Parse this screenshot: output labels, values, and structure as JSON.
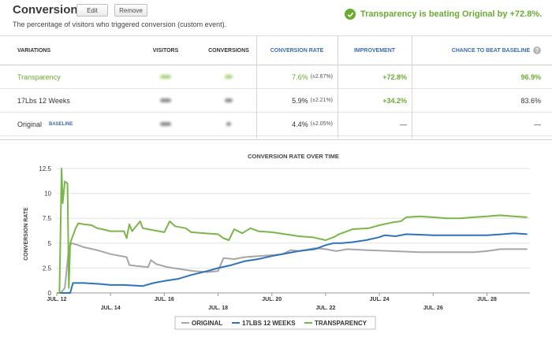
{
  "header": {
    "title": "Conversion",
    "edit_label": "Edit",
    "remove_label": "Remove",
    "subtitle": "The percentage of visitors who triggered conversion (custom event).",
    "banner": "Transparency is beating Original by +72.8%."
  },
  "table": {
    "headers": {
      "variations": "VARIATIONS",
      "visitors": "VISITORS",
      "conversions": "CONVERSIONS",
      "conversion_rate": "CONVERSION RATE",
      "improvement": "IMPROVEMENT",
      "chance": "CHANCE TO BEAT BASELINE"
    },
    "rows": [
      {
        "name": "Transparency",
        "rate": "7.6%",
        "rate_err": "(±2.67%)",
        "improvement": "+72.8%",
        "chance": "96.9%"
      },
      {
        "name": "17Lbs 12 Weeks",
        "rate": "5.9%",
        "rate_err": "(±2.21%)",
        "improvement": "+34.2%",
        "chance": "83.6%"
      },
      {
        "name": "Original",
        "baseline_tag": "BASELINE",
        "rate": "4.4%",
        "rate_err": "(±2.05%)",
        "improvement": "—",
        "chance": "—"
      }
    ]
  },
  "colors": {
    "original": "#a6a6a6",
    "weeks": "#2f72b8",
    "transparency": "#7ab648"
  },
  "chart_data": {
    "type": "line",
    "title": "CONVERSION RATE OVER TIME",
    "ylabel": "CONVERSION RATE",
    "xlabel": "",
    "ylim": [
      0,
      12.5
    ],
    "yticks": [
      0,
      2.5,
      5,
      7.5,
      10,
      12.5
    ],
    "ytick_labels": [
      "0",
      "2.5",
      "5",
      "7.5",
      "10",
      "12.5"
    ],
    "xlim": [
      12,
      29.6
    ],
    "xticks": [
      12,
      14,
      16,
      18,
      20,
      22,
      24,
      26,
      28
    ],
    "xtick_labels": [
      "JUL. 12",
      "JUL. 14",
      "JUL. 16",
      "JUL. 18",
      "JUL. 20",
      "JUL. 22",
      "JUL. 24",
      "JUL. 26",
      "JUL. 28"
    ],
    "grid": true,
    "legend": "bottom",
    "series": [
      {
        "name": "ORIGINAL",
        "points": [
          [
            12,
            0
          ],
          [
            12.15,
            0
          ],
          [
            12.3,
            0.5
          ],
          [
            12.45,
            4.5
          ],
          [
            12.55,
            5
          ],
          [
            12.8,
            4.8
          ],
          [
            13,
            4.6
          ],
          [
            13.5,
            4.3
          ],
          [
            14,
            3.9
          ],
          [
            14.6,
            3.6
          ],
          [
            14.7,
            2.8
          ],
          [
            15,
            2.7
          ],
          [
            15.4,
            2.6
          ],
          [
            15.5,
            3.3
          ],
          [
            15.7,
            2.9
          ],
          [
            16.1,
            2.6
          ],
          [
            16.6,
            2.4
          ],
          [
            17.1,
            2.2
          ],
          [
            17.6,
            2.1
          ],
          [
            18,
            2.2
          ],
          [
            18.2,
            3.5
          ],
          [
            18.6,
            3.4
          ],
          [
            19,
            3.6
          ],
          [
            19.5,
            3.7
          ],
          [
            20,
            3.8
          ],
          [
            20.4,
            3.9
          ],
          [
            20.7,
            4.3
          ],
          [
            21,
            4.2
          ],
          [
            21.6,
            4.5
          ],
          [
            22,
            4.4
          ],
          [
            22.4,
            4.2
          ],
          [
            22.8,
            4.4
          ],
          [
            23.5,
            4.3
          ],
          [
            24.5,
            4.2
          ],
          [
            25.5,
            4.1
          ],
          [
            26.5,
            4.1
          ],
          [
            27.5,
            4.1
          ],
          [
            28,
            4.2
          ],
          [
            28.5,
            4.4
          ],
          [
            29.5,
            4.4
          ]
        ]
      },
      {
        "name": "17LBS 12 WEEKS",
        "points": [
          [
            12,
            0
          ],
          [
            12.5,
            0
          ],
          [
            12.6,
            1
          ],
          [
            13,
            1
          ],
          [
            13.6,
            0.9
          ],
          [
            14,
            0.8
          ],
          [
            14.5,
            0.8
          ],
          [
            15.2,
            0.7
          ],
          [
            15.6,
            1
          ],
          [
            16,
            1.2
          ],
          [
            16.5,
            1.4
          ],
          [
            17,
            1.8
          ],
          [
            17.6,
            2.2
          ],
          [
            18,
            2.5
          ],
          [
            18.5,
            2.8
          ],
          [
            19,
            3.2
          ],
          [
            19.5,
            3.4
          ],
          [
            20,
            3.7
          ],
          [
            20.6,
            4
          ],
          [
            21,
            4.2
          ],
          [
            21.6,
            4.4
          ],
          [
            22,
            4.8
          ],
          [
            22.3,
            5
          ],
          [
            22.6,
            5
          ],
          [
            23,
            5.1
          ],
          [
            23.5,
            5.3
          ],
          [
            24,
            5.6
          ],
          [
            24.2,
            5.8
          ],
          [
            24.6,
            5.7
          ],
          [
            25,
            5.9
          ],
          [
            26,
            5.8
          ],
          [
            27,
            5.8
          ],
          [
            28,
            5.8
          ],
          [
            28.6,
            5.9
          ],
          [
            29,
            6
          ],
          [
            29.5,
            5.9
          ]
        ]
      },
      {
        "name": "TRANSPARENCY",
        "points": [
          [
            12,
            0
          ],
          [
            12.1,
            0
          ],
          [
            12.18,
            12.5
          ],
          [
            12.22,
            9
          ],
          [
            12.3,
            11.2
          ],
          [
            12.4,
            11
          ],
          [
            12.45,
            0.5
          ],
          [
            12.5,
            5
          ],
          [
            12.7,
            6.5
          ],
          [
            12.8,
            7
          ],
          [
            13,
            6.9
          ],
          [
            13.3,
            6.8
          ],
          [
            13.5,
            6.5
          ],
          [
            13.7,
            6.4
          ],
          [
            14,
            6.2
          ],
          [
            14.5,
            6.2
          ],
          [
            14.6,
            5.5
          ],
          [
            14.7,
            6.9
          ],
          [
            14.8,
            6.2
          ],
          [
            15.1,
            7.2
          ],
          [
            15.2,
            6.5
          ],
          [
            15.6,
            6.3
          ],
          [
            16,
            6.1
          ],
          [
            16.2,
            7.2
          ],
          [
            16.4,
            6.7
          ],
          [
            16.8,
            6.5
          ],
          [
            17,
            6.1
          ],
          [
            17.5,
            6
          ],
          [
            18,
            5.9
          ],
          [
            18.2,
            5.5
          ],
          [
            18.4,
            5.3
          ],
          [
            18.6,
            6.4
          ],
          [
            18.9,
            6
          ],
          [
            19.2,
            6.5
          ],
          [
            19.5,
            6.2
          ],
          [
            20,
            6.1
          ],
          [
            20.5,
            5.9
          ],
          [
            21,
            5.7
          ],
          [
            21.5,
            5.6
          ],
          [
            22,
            5.3
          ],
          [
            22.3,
            5.6
          ],
          [
            22.5,
            5.9
          ],
          [
            23,
            6.4
          ],
          [
            23.6,
            6.5
          ],
          [
            24,
            6.8
          ],
          [
            24.5,
            7.1
          ],
          [
            24.8,
            7.2
          ],
          [
            25,
            7.6
          ],
          [
            25.5,
            7.7
          ],
          [
            26,
            7.6
          ],
          [
            26.5,
            7.5
          ],
          [
            27,
            7.5
          ],
          [
            27.5,
            7.6
          ],
          [
            28,
            7.7
          ],
          [
            28.5,
            7.8
          ],
          [
            29,
            7.7
          ],
          [
            29.5,
            7.6
          ]
        ]
      }
    ]
  }
}
